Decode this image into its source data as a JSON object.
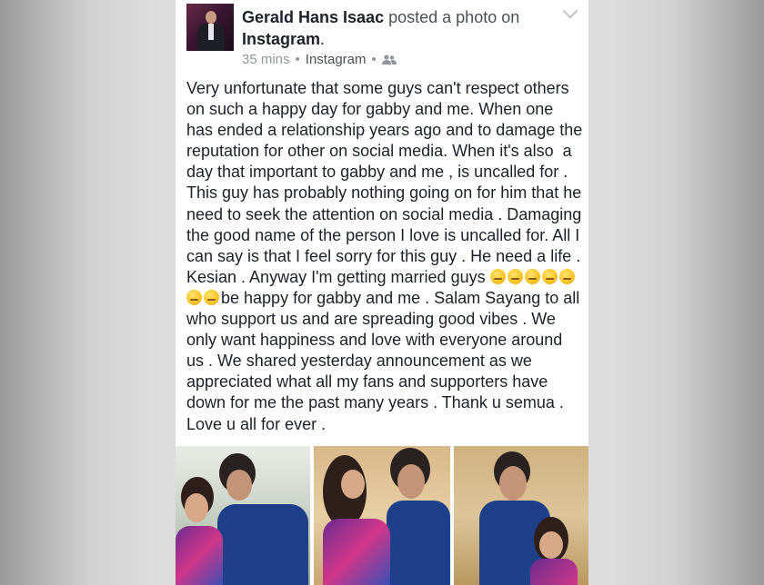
{
  "post": {
    "author": "Gerald Hans Isaac",
    "action": "posted a photo on",
    "app": "Instagram",
    "period": ".",
    "time": "35 mins",
    "source": "Instagram",
    "audience_icon": "friends-icon",
    "body_before_emoji": "Very unfortunate that some guys can't respect others on such a happy day for gabby and me. When one has ended a relationship years ago and to damage the reputation for other on social media. When it's also  a day that important to gabby and me , is uncalled for . This guy has probably nothing going on for him that he need to seek the attention on social media . Damaging the good name of the person I love is uncalled for. All I can say is that I feel sorry for this guy . He need a life . Kesian . Anyway I'm getting married guys ",
    "body_after_emoji": "be happy for gabby and me . Salam Sayang to all who support us and are spreading good vibes . We only want happiness and love with everyone around us . We shared yesterday announcement as we appreciated what all my fans and supporters have down for me the past many years . Thank u semua . Love u all for ever .",
    "emojis": [
      "expressionless-emoji",
      "smiling-emoji",
      "smiling-emoji",
      "smiling-emoji",
      "smiling-emoji",
      "smiling-emoji",
      "smiling-emoji"
    ]
  },
  "colors": {
    "text": "#1d2129",
    "meta": "#90949c",
    "card": "#ffffff"
  }
}
